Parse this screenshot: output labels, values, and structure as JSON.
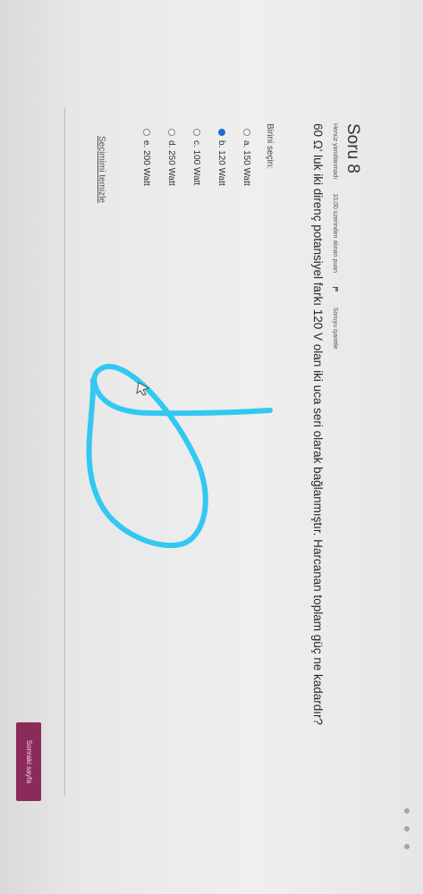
{
  "question": {
    "title": "Soru 8",
    "status": "Henüz yanıtlanmadı",
    "points": "10,00 üzerinden alınan puan",
    "flag_label": "Soruyu işaretle",
    "text": "60 Ω' luk iki direnç potansiyel farkı 120 V olan iki uca seri olarak bağlanmıştır. Harcanan toplam güç ne kadardır?",
    "prompt": "Birini seçin:",
    "options": [
      {
        "label": "a. 150 Watt",
        "selected": false
      },
      {
        "label": "b. 120 Watt",
        "selected": true
      },
      {
        "label": "c. 100 Watt",
        "selected": false
      },
      {
        "label": "d. 250 Watt",
        "selected": false
      },
      {
        "label": "e. 200 Watt",
        "selected": false
      }
    ],
    "clear_label": "Seçimimi temizle"
  },
  "navigation": {
    "next_label": "Sonraki sayfa"
  },
  "colors": {
    "selected_radio": "#1f6fd1",
    "next_button": "#8c2a5a",
    "pen_stroke": "#33c8f2"
  }
}
